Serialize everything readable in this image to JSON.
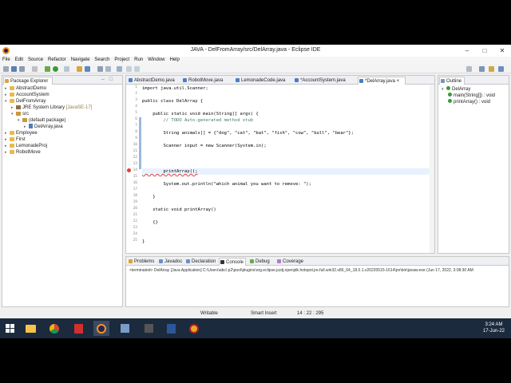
{
  "window": {
    "title": "JAVA - DelFromArray/src/DelArray.java - Eclipse IDE"
  },
  "menu": [
    "File",
    "Edit",
    "Source",
    "Refactor",
    "Navigate",
    "Search",
    "Project",
    "Run",
    "Window",
    "Help"
  ],
  "package_explorer": {
    "tab_label": "Package Explorer",
    "items": [
      "AbstractDemo",
      "AccountSystem",
      "DelFromArray",
      "JRE System Library",
      "[JavaSE-17]",
      "src",
      "(default package)",
      "DelArray.java",
      "Employee",
      "First",
      "LemonadeProj",
      "RobotMove"
    ]
  },
  "editor": {
    "tabs": [
      "AbstractDemo.java",
      "RobotMove.java",
      "LemonadeCode.java",
      "*AccountSystem.java",
      "*DelArray.java"
    ],
    "line_numbers": [
      "1",
      "2",
      "3",
      "4",
      "5",
      "6",
      "7",
      "8",
      "9",
      "10",
      "11",
      "12",
      "13",
      "14",
      "15",
      "16",
      "17",
      "18",
      "19",
      "20",
      "21",
      "22",
      "23",
      "24",
      "25"
    ],
    "code": {
      "l1": "import java.util.Scanner;",
      "l3": "public class DelArray {",
      "l5": "    public static void main(String[] args) {",
      "l6": "        // TODO Auto-generated method stub",
      "l8": "        String animals[] = {\"dog\", \"cat\", \"bat\", \"fish\", \"cow\", \"bull\", \"bear\"};",
      "l10": "        Scanner input = new Scanner(System.in);",
      "l12": "        printArray();",
      "l14": "        System.out.println(\"which animal you want to remove: \");",
      "l16": "    }",
      "l18": "    static void printArray()",
      "l19": "    {}",
      "l22": "}"
    }
  },
  "outline": {
    "tab_label": "Outline",
    "items": [
      "DelArray",
      "main(String[]) : void",
      "printArray() : void"
    ]
  },
  "bottom_panel": {
    "tabs": [
      "Problems",
      "Javadoc",
      "Declaration",
      "Console",
      "Debug",
      "Coverage"
    ],
    "console_text": "<terminated> DelArray [Java Application] C:\\Users\\abc\\.p2\\pool\\plugins\\org.eclipse.justj.openjdk.hotspot.jre.full.win32.x86_64_18.0.1.v20220515-1614\\jre\\bin\\javaw.exe (Jun 17, 2022, 3:08:30 AM"
  },
  "status": {
    "writable": "Writable",
    "insert_mode": "Smart Insert",
    "position": "14 : 22 : 295"
  },
  "taskbar": {
    "time": "3:24 AM",
    "date": "17-Jun-22"
  }
}
